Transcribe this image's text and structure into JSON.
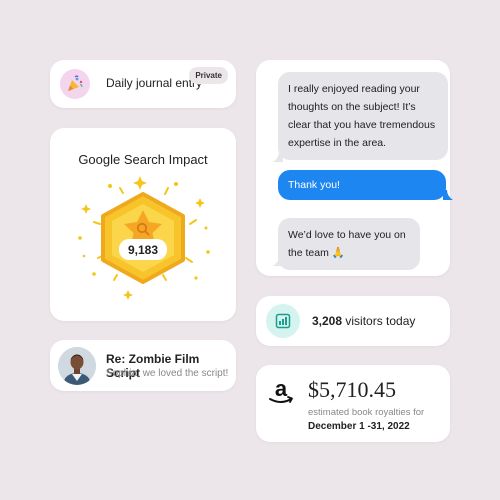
{
  "journal": {
    "title": "Daily journal entry",
    "badge": "Private",
    "icon": "party-popper-icon"
  },
  "impact": {
    "title": "Google Search Impact",
    "count": "9,183",
    "icon": "star-search-badge-icon"
  },
  "email": {
    "subject": "Re: Zombie Film Script",
    "preview": "Sophia, we loved the script!"
  },
  "chat": {
    "messages": [
      {
        "direction": "incoming",
        "text": "I really enjoyed reading your thoughts on the subject! It’s clear that you have tremendous expertise in the area."
      },
      {
        "direction": "outgoing",
        "text": "Thank you!"
      },
      {
        "direction": "incoming",
        "text": "We’d love to have you on the team 🙏"
      }
    ]
  },
  "visitors": {
    "count": "3,208",
    "label": "visitors today",
    "icon": "analytics-chart-icon"
  },
  "royalties": {
    "amount": "$5,710.45",
    "label": "estimated book royalties for",
    "period": "December 1 -31, 2022",
    "logo": "amazon-logo"
  },
  "colors": {
    "background": "#ece6ea",
    "outgoing_bubble": "#1d86f0",
    "incoming_bubble": "#e5e5ea",
    "badge_gold": "#f5c518"
  }
}
